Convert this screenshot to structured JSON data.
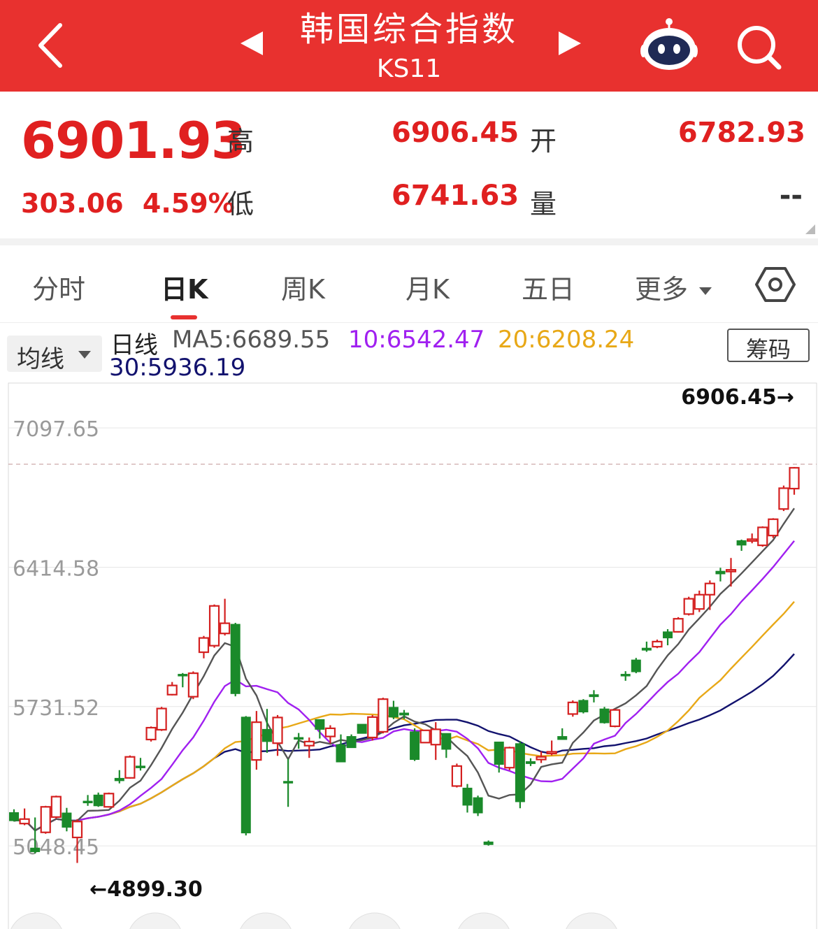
{
  "header": {
    "title": "韩国综合指数",
    "code": "KS11",
    "back_icon": "chevron-left-icon",
    "prev_icon": "triangle-left-icon",
    "next_icon": "triangle-right-icon",
    "robot_icon": "robot-assistant-icon",
    "search_icon": "search-icon",
    "bg_color": "#e8312f"
  },
  "quote": {
    "price": "6901.93",
    "change": "303.06",
    "change_pct": "4.59%",
    "high_label": "高",
    "high": "6906.45",
    "open_label": "开",
    "open": "6782.93",
    "low_label": "低",
    "low": "6741.63",
    "volume_label": "量",
    "volume": "--",
    "up_color": "#e02020"
  },
  "tabs": {
    "items": [
      "分时",
      "日K",
      "周K",
      "月K",
      "五日",
      "更多"
    ],
    "active": "日K",
    "settings_icon": "hexagon-settings-icon"
  },
  "legend": {
    "ma_select": "均线",
    "period": "日线",
    "ma5": "MA5:6689.55",
    "ma10": "10:6542.47",
    "ma20": "20:6208.24",
    "ma30": "30:5936.19",
    "chips_button": "筹码",
    "colors": {
      "ma5": "#555555",
      "ma10": "#a020f0",
      "ma20": "#e8a817",
      "ma30": "#12126e"
    }
  },
  "chart_data": {
    "type": "candlestick",
    "y_ticks": [
      "7097.65",
      "6414.58",
      "5731.52",
      "5048.45"
    ],
    "ylim": [
      4720,
      7290
    ],
    "high_marker": "6906.45→",
    "low_marker": "←4899.30",
    "up_color": "#d42020",
    "down_color": "#1a8a2a",
    "candles": [
      [
        5212,
        5172,
        5228,
        5168
      ],
      [
        5158,
        5180,
        5232,
        5150
      ],
      [
        5038,
        5020,
        5188,
        5012
      ],
      [
        5115,
        5240,
        5245,
        5108
      ],
      [
        5190,
        5290,
        5295,
        5182
      ],
      [
        5210,
        5140,
        5235,
        5120
      ],
      [
        5090,
        5168,
        5180,
        4965
      ],
      [
        5268,
        5265,
        5298,
        5245
      ],
      [
        5298,
        5245,
        5310,
        5240
      ],
      [
        5240,
        5305,
        5310,
        5236
      ],
      [
        5380,
        5368,
        5420,
        5355
      ],
      [
        5382,
        5485,
        5492,
        5378
      ],
      [
        5440,
        5438,
        5480,
        5418
      ],
      [
        5570,
        5628,
        5634,
        5560
      ],
      [
        5618,
        5722,
        5730,
        5612
      ],
      [
        5790,
        5835,
        5852,
        5786
      ],
      [
        5890,
        5885,
        5896,
        5826
      ],
      [
        5780,
        5895,
        5904,
        5768
      ],
      [
        5998,
        6068,
        6078,
        5968
      ],
      [
        6030,
        6225,
        6232,
        6020
      ],
      [
        6090,
        6140,
        6260,
        6080
      ],
      [
        6135,
        5795,
        6142,
        5782
      ],
      [
        5680,
        5112,
        5685,
        5100
      ],
      [
        5470,
        5655,
        5710,
        5422
      ],
      [
        5620,
        5560,
        5720,
        5505
      ],
      [
        5552,
        5678,
        5690,
        5490
      ],
      [
        5365,
        5362,
        5475,
        5240
      ],
      [
        5580,
        5575,
        5602,
        5525
      ],
      [
        5540,
        5560,
        5580,
        5480
      ],
      [
        5668,
        5620,
        5668,
        5575
      ],
      [
        5585,
        5625,
        5640,
        5550
      ],
      [
        5545,
        5460,
        5595,
        5460
      ],
      [
        5585,
        5530,
        5595,
        5545
      ],
      [
        5645,
        5600,
        5645,
        5600
      ],
      [
        5580,
        5680,
        5690,
        5565
      ],
      [
        5608,
        5768,
        5775,
        5600
      ],
      [
        5728,
        5680,
        5760,
        5670
      ],
      [
        5700,
        5690,
        5715,
        5670
      ],
      [
        5608,
        5472,
        5625,
        5465
      ],
      [
        5555,
        5615,
        5608,
        5555
      ],
      [
        5545,
        5620,
        5655,
        5470
      ],
      [
        5600,
        5522,
        5600,
        5480
      ],
      [
        5342,
        5440,
        5452,
        5335
      ],
      [
        5332,
        5248,
        5352,
        5212
      ],
      [
        5285,
        5210,
        5295,
        5195
      ],
      [
        5068,
        5055,
        5075,
        5050
      ],
      [
        5558,
        5448,
        5558,
        5408
      ],
      [
        5432,
        5530,
        5535,
        5420
      ],
      [
        5550,
        5265,
        5562,
        5233
      ],
      [
        5462,
        5452,
        5478,
        5440
      ],
      [
        5472,
        5485,
        5512,
        5455
      ],
      [
        5510,
        5510,
        5565,
        5492
      ],
      [
        5585,
        5570,
        5625,
        5570
      ],
      [
        5695,
        5752,
        5762,
        5682
      ],
      [
        5762,
        5705,
        5768,
        5698
      ],
      [
        5790,
        5780,
        5812,
        5752
      ],
      [
        5720,
        5652,
        5730,
        5648
      ],
      [
        5635,
        5715,
        5720,
        5630
      ],
      [
        5890,
        5885,
        5905,
        5858
      ],
      [
        5960,
        5902,
        5970,
        5895
      ],
      [
        6018,
        6008,
        6050,
        6000
      ],
      [
        6025,
        6050,
        6060,
        6018
      ],
      [
        6098,
        6068,
        6111,
        6032
      ],
      [
        6098,
        6162,
        6170,
        6094
      ],
      [
        6185,
        6260,
        6270,
        6178
      ],
      [
        6210,
        6280,
        6300,
        6195
      ],
      [
        6280,
        6335,
        6350,
        6205
      ],
      [
        6395,
        6382,
        6412,
        6345
      ],
      [
        6400,
        6402,
        6460,
        6320
      ],
      [
        6545,
        6523,
        6550,
        6495
      ],
      [
        6545,
        6552,
        6580,
        6532
      ],
      [
        6522,
        6610,
        6615,
        6515
      ],
      [
        6570,
        6650,
        6655,
        6558
      ],
      [
        6700,
        6802,
        6815,
        6690
      ],
      [
        6800,
        6902,
        6906,
        6770
      ]
    ]
  }
}
